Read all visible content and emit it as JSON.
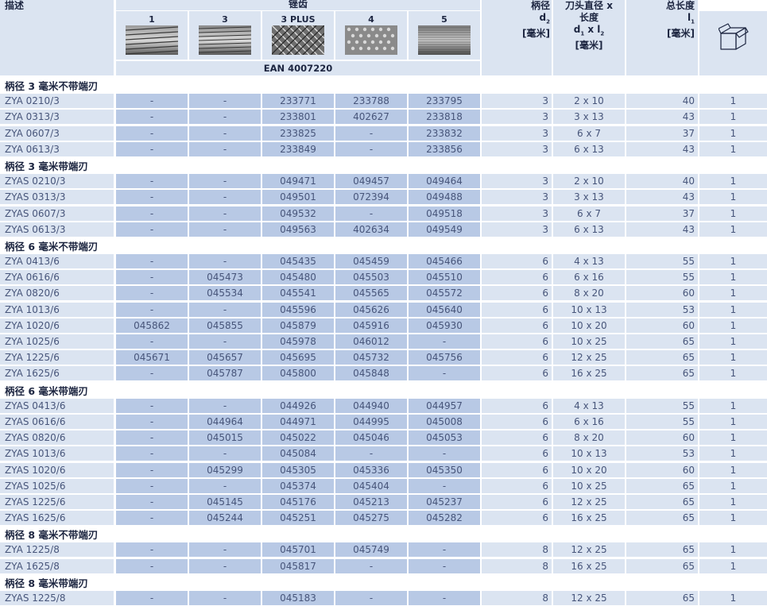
{
  "header": {
    "desc": "描述",
    "cut": "锉齿",
    "shank_title": "柄径",
    "shank_sym": "d",
    "shank_sub": "2",
    "unit": "[毫米]",
    "dim_title1": "刀头直径 x",
    "dim_title2": "长度",
    "dim_sym1": "d",
    "dim_sub1": "1",
    "dim_x": "x l",
    "dim_sub2": "2",
    "len_title": "总长度",
    "len_sym": "l",
    "len_sub": "1",
    "ean": "EAN 4007220",
    "grades": [
      "1",
      "3",
      "3 PLUS",
      "4",
      "5"
    ],
    "box_icon": "box-icon"
  },
  "sections": [
    {
      "title": "柄径 3 毫米不带端刃",
      "rows": [
        {
          "desc": "ZYA 0210/3",
          "g1": "-",
          "g2": "-",
          "g3": "233771",
          "g4": "233788",
          "g5": "233795",
          "shank": "3",
          "dim": "2 x 10",
          "len": "40",
          "pack": "1"
        },
        {
          "desc": "ZYA 0313/3",
          "g1": "-",
          "g2": "-",
          "g3": "233801",
          "g4": "402627",
          "g5": "233818",
          "shank": "3",
          "dim": "3 x 13",
          "len": "43",
          "pack": "1"
        },
        {
          "desc": "ZYA 0607/3",
          "g1": "-",
          "g2": "-",
          "g3": "233825",
          "g4": "-",
          "g5": "233832",
          "shank": "3",
          "dim": "6 x 7",
          "len": "37",
          "pack": "1"
        },
        {
          "desc": "ZYA 0613/3",
          "g1": "-",
          "g2": "-",
          "g3": "233849",
          "g4": "-",
          "g5": "233856",
          "shank": "3",
          "dim": "6 x 13",
          "len": "43",
          "pack": "1"
        }
      ]
    },
    {
      "title": "柄径 3 毫米带端刃",
      "rows": [
        {
          "desc": "ZYAS 0210/3",
          "g1": "-",
          "g2": "-",
          "g3": "049471",
          "g4": "049457",
          "g5": "049464",
          "shank": "3",
          "dim": "2 x 10",
          "len": "40",
          "pack": "1"
        },
        {
          "desc": "ZYAS 0313/3",
          "g1": "-",
          "g2": "-",
          "g3": "049501",
          "g4": "072394",
          "g5": "049488",
          "shank": "3",
          "dim": "3 x 13",
          "len": "43",
          "pack": "1"
        },
        {
          "desc": "ZYAS 0607/3",
          "g1": "-",
          "g2": "-",
          "g3": "049532",
          "g4": "-",
          "g5": "049518",
          "shank": "3",
          "dim": "6 x 7",
          "len": "37",
          "pack": "1"
        },
        {
          "desc": "ZYAS 0613/3",
          "g1": "-",
          "g2": "-",
          "g3": "049563",
          "g4": "402634",
          "g5": "049549",
          "shank": "3",
          "dim": "6 x 13",
          "len": "43",
          "pack": "1"
        }
      ]
    },
    {
      "title": "柄径 6 毫米不带端刃",
      "rows": [
        {
          "desc": "ZYA 0413/6",
          "g1": "-",
          "g2": "-",
          "g3": "045435",
          "g4": "045459",
          "g5": "045466",
          "shank": "6",
          "dim": "4 x 13",
          "len": "55",
          "pack": "1"
        },
        {
          "desc": "ZYA 0616/6",
          "g1": "-",
          "g2": "045473",
          "g3": "045480",
          "g4": "045503",
          "g5": "045510",
          "shank": "6",
          "dim": "6 x 16",
          "len": "55",
          "pack": "1"
        },
        {
          "desc": "ZYA 0820/6",
          "g1": "-",
          "g2": "045534",
          "g3": "045541",
          "g4": "045565",
          "g5": "045572",
          "shank": "6",
          "dim": "8 x 20",
          "len": "60",
          "pack": "1"
        },
        {
          "desc": "ZYA 1013/6",
          "g1": "-",
          "g2": "-",
          "g3": "045596",
          "g4": "045626",
          "g5": "045640",
          "shank": "6",
          "dim": "10 x 13",
          "len": "53",
          "pack": "1"
        },
        {
          "desc": "ZYA 1020/6",
          "g1": "045862",
          "g2": "045855",
          "g3": "045879",
          "g4": "045916",
          "g5": "045930",
          "shank": "6",
          "dim": "10 x 20",
          "len": "60",
          "pack": "1"
        },
        {
          "desc": "ZYA 1025/6",
          "g1": "-",
          "g2": "-",
          "g3": "045978",
          "g4": "046012",
          "g5": "-",
          "shank": "6",
          "dim": "10 x 25",
          "len": "65",
          "pack": "1"
        },
        {
          "desc": "ZYA 1225/6",
          "g1": "045671",
          "g2": "045657",
          "g3": "045695",
          "g4": "045732",
          "g5": "045756",
          "shank": "6",
          "dim": "12 x 25",
          "len": "65",
          "pack": "1"
        },
        {
          "desc": "ZYA 1625/6",
          "g1": "-",
          "g2": "045787",
          "g3": "045800",
          "g4": "045848",
          "g5": "-",
          "shank": "6",
          "dim": "16 x 25",
          "len": "65",
          "pack": "1"
        }
      ]
    },
    {
      "title": "柄径 6 毫米带端刃",
      "rows": [
        {
          "desc": "ZYAS 0413/6",
          "g1": "-",
          "g2": "-",
          "g3": "044926",
          "g4": "044940",
          "g5": "044957",
          "shank": "6",
          "dim": "4 x 13",
          "len": "55",
          "pack": "1"
        },
        {
          "desc": "ZYAS 0616/6",
          "g1": "-",
          "g2": "044964",
          "g3": "044971",
          "g4": "044995",
          "g5": "045008",
          "shank": "6",
          "dim": "6 x 16",
          "len": "55",
          "pack": "1"
        },
        {
          "desc": "ZYAS 0820/6",
          "g1": "-",
          "g2": "045015",
          "g3": "045022",
          "g4": "045046",
          "g5": "045053",
          "shank": "6",
          "dim": "8 x 20",
          "len": "60",
          "pack": "1"
        },
        {
          "desc": "ZYAS 1013/6",
          "g1": "-",
          "g2": "-",
          "g3": "045084",
          "g4": "-",
          "g5": "-",
          "shank": "6",
          "dim": "10 x 13",
          "len": "53",
          "pack": "1"
        },
        {
          "desc": "ZYAS 1020/6",
          "g1": "-",
          "g2": "045299",
          "g3": "045305",
          "g4": "045336",
          "g5": "045350",
          "shank": "6",
          "dim": "10 x 20",
          "len": "60",
          "pack": "1"
        },
        {
          "desc": "ZYAS 1025/6",
          "g1": "-",
          "g2": "-",
          "g3": "045374",
          "g4": "045404",
          "g5": "-",
          "shank": "6",
          "dim": "10 x 25",
          "len": "65",
          "pack": "1"
        },
        {
          "desc": "ZYAS 1225/6",
          "g1": "-",
          "g2": "045145",
          "g3": "045176",
          "g4": "045213",
          "g5": "045237",
          "shank": "6",
          "dim": "12 x 25",
          "len": "65",
          "pack": "1"
        },
        {
          "desc": "ZYAS 1625/6",
          "g1": "-",
          "g2": "045244",
          "g3": "045251",
          "g4": "045275",
          "g5": "045282",
          "shank": "6",
          "dim": "16 x 25",
          "len": "65",
          "pack": "1"
        }
      ]
    },
    {
      "title": "柄径 8 毫米不带端刃",
      "rows": [
        {
          "desc": "ZYA 1225/8",
          "g1": "-",
          "g2": "-",
          "g3": "045701",
          "g4": "045749",
          "g5": "-",
          "shank": "8",
          "dim": "12 x 25",
          "len": "65",
          "pack": "1"
        },
        {
          "desc": "ZYA 1625/8",
          "g1": "-",
          "g2": "-",
          "g3": "045817",
          "g4": "-",
          "g5": "-",
          "shank": "8",
          "dim": "16 x 25",
          "len": "65",
          "pack": "1"
        }
      ]
    },
    {
      "title": "柄径 8 毫米带端刃",
      "rows": [
        {
          "desc": "ZYAS 1225/8",
          "g1": "-",
          "g2": "-",
          "g3": "045183",
          "g4": "-",
          "g5": "-",
          "shank": "8",
          "dim": "12 x 25",
          "len": "65",
          "pack": "1"
        }
      ]
    }
  ]
}
